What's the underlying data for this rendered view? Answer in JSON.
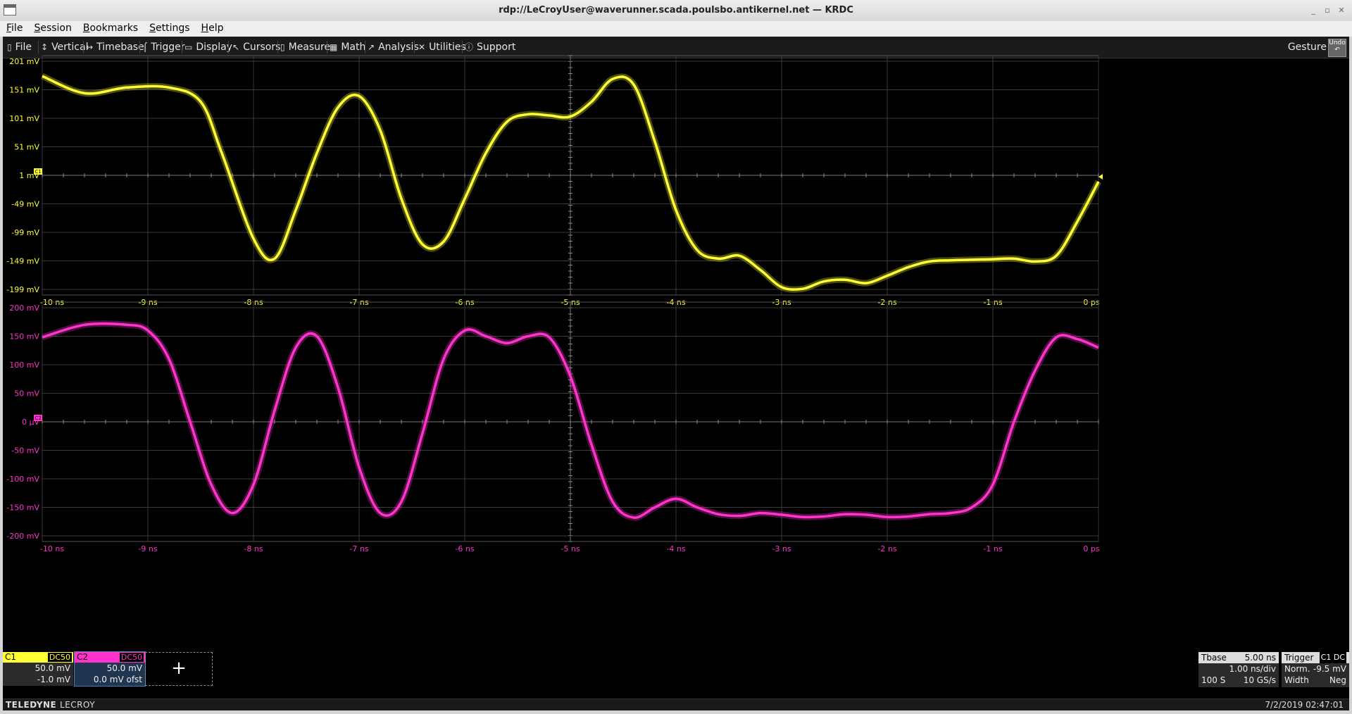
{
  "window": {
    "title": "rdp://LeCroyUser@waverunner.scada.poulsbo.antikernel.net — KRDC"
  },
  "menubar": [
    "File",
    "Session",
    "Bookmarks",
    "Settings",
    "Help"
  ],
  "toolbar": {
    "items": [
      "File",
      "Vertical",
      "Timebase",
      "Trigger",
      "Display",
      "Cursors",
      "Measure",
      "Math",
      "Analysis",
      "Utilities",
      "Support"
    ],
    "gesture": "Gesture",
    "undo": "Undo"
  },
  "chart_data": [
    {
      "type": "line",
      "series": [
        {
          "name": "C1",
          "color": "#ffff33"
        }
      ],
      "ylabels": [
        "201 mV",
        "151 mV",
        "101 mV",
        "51 mV",
        "1 mV",
        "-49 mV",
        "-99 mV",
        "-149 mV",
        "-199 mV"
      ],
      "xlabels": [
        "-10 ns",
        "-9 ns",
        "-8 ns",
        "-7 ns",
        "-6 ns",
        "-5 ns",
        "-4 ns",
        "-3 ns",
        "-2 ns",
        "-1 ns",
        "0 ps"
      ],
      "xlim": [
        -10,
        0
      ],
      "ylim": [
        -199,
        201
      ],
      "x": [
        -10.0,
        -9.6,
        -9.2,
        -8.8,
        -8.5,
        -8.3,
        -8.0,
        -7.8,
        -7.6,
        -7.4,
        -7.2,
        -7.0,
        -6.8,
        -6.6,
        -6.4,
        -6.2,
        -6.0,
        -5.8,
        -5.6,
        -5.4,
        -5.2,
        -5.0,
        -4.8,
        -4.6,
        -4.4,
        -4.2,
        -4.0,
        -3.8,
        -3.6,
        -3.4,
        -3.2,
        -3.0,
        -2.8,
        -2.6,
        -2.4,
        -2.2,
        -2.0,
        -1.8,
        -1.6,
        -1.4,
        -1.2,
        -1.0,
        -0.8,
        -0.6,
        -0.4,
        -0.2,
        0.0
      ],
      "values": [
        175,
        145,
        155,
        155,
        130,
        40,
        -110,
        -145,
        -60,
        40,
        120,
        140,
        80,
        -40,
        -120,
        -115,
        -40,
        40,
        95,
        108,
        106,
        104,
        130,
        170,
        160,
        60,
        -60,
        -130,
        -145,
        -140,
        -165,
        -195,
        -198,
        -185,
        -182,
        -188,
        -175,
        -160,
        -150,
        -148,
        -147,
        -146,
        -145,
        -150,
        -140,
        -80,
        -10
      ],
      "marker_label": "C1"
    },
    {
      "type": "line",
      "series": [
        {
          "name": "C2",
          "color": "#ff33cc"
        }
      ],
      "ylabels": [
        "200 mV",
        "150 mV",
        "100 mV",
        "50 mV",
        "0 µV",
        "-50 mV",
        "-100 mV",
        "-150 mV",
        "-200 mV"
      ],
      "xlabels": [
        "-10 ns",
        "-9 ns",
        "-8 ns",
        "-7 ns",
        "-6 ns",
        "-5 ns",
        "-4 ns",
        "-3 ns",
        "-2 ns",
        "-1 ns",
        "0 ps"
      ],
      "xlim": [
        -10,
        0
      ],
      "ylim": [
        -200,
        200
      ],
      "x": [
        -10.0,
        -9.6,
        -9.2,
        -9.0,
        -8.8,
        -8.6,
        -8.4,
        -8.2,
        -8.0,
        -7.8,
        -7.6,
        -7.4,
        -7.2,
        -7.0,
        -6.8,
        -6.6,
        -6.4,
        -6.2,
        -6.0,
        -5.8,
        -5.6,
        -5.4,
        -5.2,
        -5.0,
        -4.8,
        -4.6,
        -4.4,
        -4.2,
        -4.0,
        -3.8,
        -3.6,
        -3.4,
        -3.2,
        -3.0,
        -2.8,
        -2.6,
        -2.4,
        -2.2,
        -2.0,
        -1.8,
        -1.6,
        -1.4,
        -1.2,
        -1.0,
        -0.8,
        -0.6,
        -0.4,
        -0.2,
        0.0
      ],
      "values": [
        148,
        170,
        170,
        160,
        110,
        0,
        -110,
        -160,
        -110,
        20,
        130,
        150,
        60,
        -80,
        -160,
        -140,
        -20,
        110,
        160,
        150,
        138,
        150,
        148,
        80,
        -40,
        -140,
        -168,
        -150,
        -135,
        -150,
        -162,
        -165,
        -160,
        -163,
        -167,
        -166,
        -162,
        -163,
        -167,
        -166,
        -162,
        -160,
        -150,
        -110,
        0,
        90,
        148,
        145,
        130
      ],
      "marker_label": "C2"
    }
  ],
  "channels": [
    {
      "name": "C1",
      "coupling": "DC50",
      "scale": "50.0 mV",
      "offset": "-1.0 mV"
    },
    {
      "name": "C2",
      "coupling": "DC50",
      "scale": "50.0 mV",
      "offset": "0.0 mV ofst"
    }
  ],
  "add_channel": "+",
  "timebase": {
    "label": "Tbase",
    "value": "5.00 ns",
    "per_div": "1.00 ns/div",
    "samples": "100 S",
    "rate": "10 GS/s"
  },
  "trigger": {
    "label": "Trigger",
    "source": "C1",
    "coupling": "DC",
    "mode": "Norm.",
    "level": "-9.5 mV",
    "type": "Width",
    "slope": "Neg"
  },
  "status": {
    "brand_bold": "TELEDYNE",
    "brand": "LECROY",
    "datetime": "7/2/2019 02:47:01"
  },
  "colors": {
    "c1": "#ffff33",
    "c2": "#ff33cc",
    "grid": "#4a4a4a",
    "background": "#000000"
  }
}
